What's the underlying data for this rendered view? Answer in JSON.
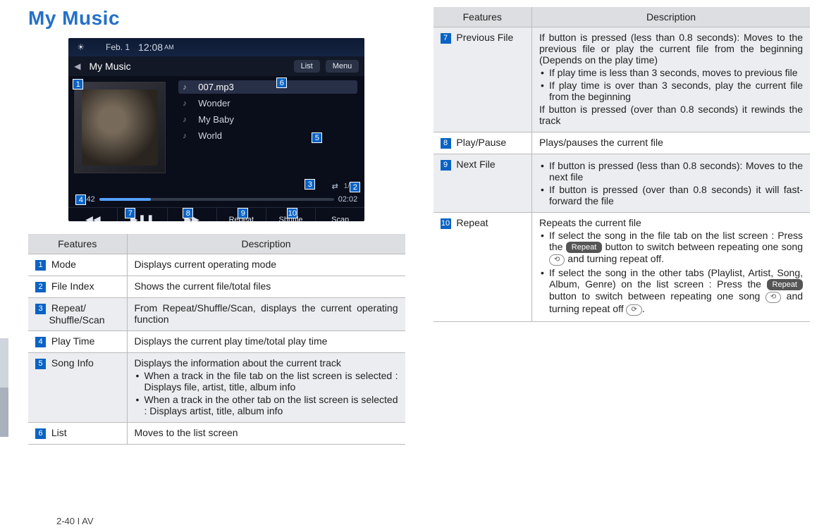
{
  "page_title": "My Music",
  "footer": "2-40 I AV",
  "screenshot": {
    "date": "Feb.  1",
    "day_icon": "☀",
    "time": "12:08",
    "ampm": "AM",
    "back": "◀",
    "title_label": "My Music",
    "btn_list": "List",
    "btn_menu": "Menu",
    "songs": [
      "007.mp3",
      "Wonder",
      "My Baby",
      "World"
    ],
    "file_index": "1/16",
    "time_elapsed": "00:42",
    "time_total": "02:02",
    "controls": {
      "prev": "◀◀",
      "play": "▶❚❚",
      "next": "▶▶",
      "repeat": "Repeat",
      "shuffle": "Shuffle",
      "scan": "Scan"
    },
    "callouts": {
      "1": "1",
      "2": "2",
      "3": "3",
      "4": "4",
      "5": "5",
      "6": "6",
      "7": "7",
      "8": "8",
      "9": "9",
      "10": "10"
    }
  },
  "table_headers": {
    "features": "Features",
    "description": "Description"
  },
  "rows_left": [
    {
      "num": "1",
      "feature": "Mode",
      "desc_plain": "Displays current operating mode"
    },
    {
      "num": "2",
      "feature": "File Index",
      "desc_plain": "Shows the current file/total files"
    },
    {
      "num": "3",
      "feature": "Repeat/\nShuffle/Scan",
      "desc_plain": "From Repeat/Shuffle/Scan, displays the current operating function"
    },
    {
      "num": "4",
      "feature": "Play Time",
      "desc_plain": "Displays the current play time/total play time"
    },
    {
      "num": "5",
      "feature": "Song Info",
      "desc_intro": "Displays the information about the current track",
      "desc_list": [
        "When a track in the file tab on the list screen is selected : Displays file, artist, title, album info",
        "When a track in the other tab on the list screen is selected : Displays artist, title, album info"
      ]
    },
    {
      "num": "6",
      "feature": "List",
      "desc_plain": "Moves to the list screen"
    }
  ],
  "rows_right": [
    {
      "num": "7",
      "feature": "Previous File",
      "desc_intro": "If button is pressed (less than 0.8 seconds): Moves to the previous file or play the current file from the beginning (Depends on the play time)",
      "desc_list": [
        "If play time is less than 3 seconds, moves to previous file",
        "If play time is over than 3 seconds, play the current file from the beginning"
      ],
      "desc_outro": "If button is pressed (over than 0.8 seconds) it rewinds the track"
    },
    {
      "num": "8",
      "feature": "Play/Pause",
      "desc_plain": "Plays/pauses the current file"
    },
    {
      "num": "9",
      "feature": "Next File",
      "desc_list": [
        "If button is pressed (less than 0.8 seconds): Moves to the next file",
        "If button is pressed (over than 0.8 seconds) it will fast-forward the file"
      ]
    },
    {
      "num": "10",
      "feature": "Repeat",
      "desc_intro": "Repeats the current file",
      "desc_html_list": [
        "If select the song in the file tab on the list screen : Press the <span class='lbl-btn'>Repeat</span> button to switch between repeating one song <span class='lbl-icon'>⟲</span> and turning repeat off.",
        "If select the song in the other tabs (Playlist, Artist, Song, Album, Genre) on the list screen : Press the <span class='lbl-btn'>Repeat</span> button to switch between repeating one song <span class='lbl-icon'>⟲</span> and turning repeat off <span class='lbl-icon'>⟳</span>."
      ]
    }
  ]
}
